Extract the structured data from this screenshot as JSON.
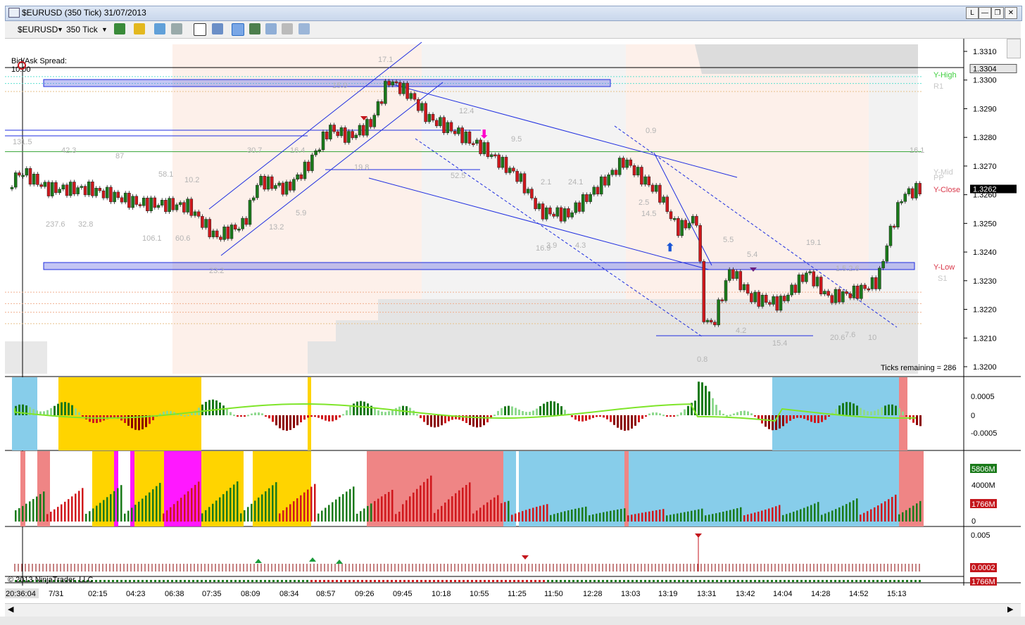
{
  "window": {
    "title": "$EURUSD (350 Tick)  31/07/2013",
    "buttons": {
      "l": "L",
      "min": "—",
      "restore": "❐",
      "close": "✕"
    }
  },
  "toolbar": {
    "instrument": "$EURUSD",
    "interval": "350 Tick",
    "icons": [
      "bar-type-icon",
      "drawing-tool-icon",
      "properties-icon",
      "crosshair-icon",
      "zoom-icon",
      "data-box-icon",
      "chart-trader-icon",
      "strategies-icon",
      "indicators-icon",
      "templates-icon"
    ]
  },
  "price_axis": {
    "labels": [
      "1.3310",
      "1.3304",
      "1.3300",
      "1.3290",
      "1.3280",
      "1.3270",
      "1.3262",
      "1.3260",
      "1.3250",
      "1.3240",
      "1.3230",
      "1.3220",
      "1.3210",
      "1.3200"
    ],
    "current_price": "1.3262",
    "marker_1304": "1.3304"
  },
  "main_panel": {
    "bidask_label": "Bid/Ask Spread:",
    "bidask_value": "10.00",
    "ticks_remaining": "Ticks remaining = 286",
    "levels": [
      "Y-High",
      "R1",
      "Y-Mid",
      "PP",
      "Y-Close",
      "Y-Low",
      "S1"
    ],
    "volume_labels": [
      "17.1",
      "15.0",
      "12.4",
      "9.5",
      "0.9",
      "2.1",
      "24.1",
      "52.5",
      "19.8",
      "16.4",
      "30.7",
      "58.1",
      "87",
      "42.3",
      "131.5",
      "10.2",
      "237.6",
      "32.8",
      "106.1",
      "60.6",
      "23.2",
      "13.2",
      "5.9",
      "2.5",
      "16.9",
      "3.9",
      "4.3",
      "14.5",
      "5.5",
      "5.4",
      "19.1",
      "4.2",
      "15.4",
      "0.8",
      "7.6",
      "20.6",
      "10",
      "16.1",
      "1.5.2.6"
    ]
  },
  "osc_panel": {
    "labels": [
      "0.0005",
      "0",
      "-0.0005"
    ]
  },
  "vol_panel": {
    "labels": [
      "5806M",
      "4000M",
      "1766M",
      "0"
    ]
  },
  "bottom_panel": {
    "labels": [
      "0.005",
      "0.0002"
    ],
    "last_vol": "1766M"
  },
  "copyright": "© 2013 NinjaTrader, LLC",
  "time_axis": [
    "20:36:04",
    "7/31",
    "02:15",
    "04:23",
    "06:38",
    "07:35",
    "08:09",
    "08:34",
    "08:57",
    "09:26",
    "09:45",
    "10:18",
    "10:55",
    "11:25",
    "11:50",
    "12:28",
    "13:03",
    "13:19",
    "13:31",
    "13:42",
    "14:04",
    "14:28",
    "14:52",
    "15:13"
  ],
  "colors": {
    "bull": "#1a7a1a",
    "bear": "#d0171c",
    "channel": "#1f2ee0",
    "band": "#7b7fe6",
    "blue_bg": "#87cdea",
    "gold_bg": "#ffd400",
    "magenta_bg": "#ff18ff",
    "red_bg": "#ef8585",
    "lime": "#7fe52a"
  }
}
